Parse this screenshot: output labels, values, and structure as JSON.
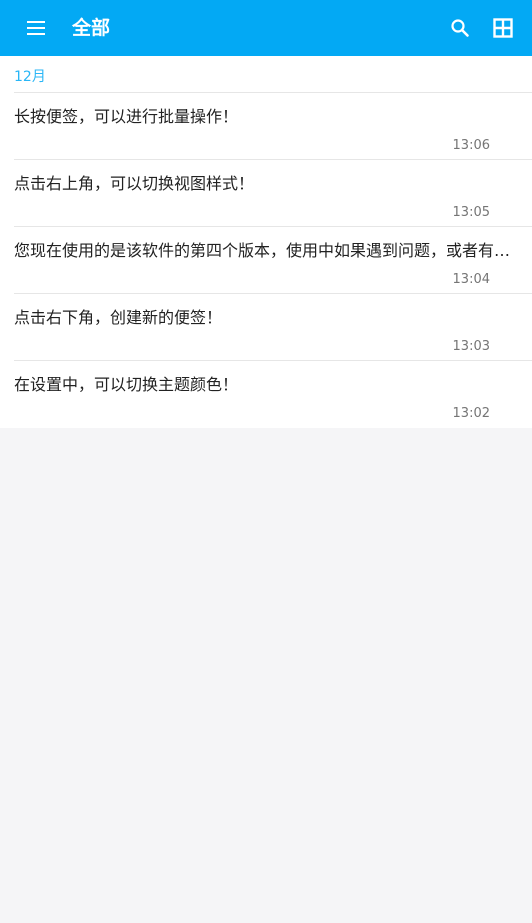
{
  "appbar": {
    "title": "全部",
    "menu_icon": "menu-icon",
    "search_icon": "search-icon",
    "view_icon": "grid-view-icon",
    "color": "#03a9f4"
  },
  "section": {
    "header": "12月"
  },
  "notes": [
    {
      "text": "长按便签，可以进行批量操作！",
      "time": "13:06"
    },
    {
      "text": "点击右上角，可以切换视图样式！",
      "time": "13:05"
    },
    {
      "text": "您现在使用的是该软件的第四个版本，使用中如果遇到问题，或者有…",
      "time": "13:04"
    },
    {
      "text": "点击右下角，创建新的便签！",
      "time": "13:03"
    },
    {
      "text": "在设置中，可以切换主题颜色！",
      "time": "13:02"
    }
  ]
}
